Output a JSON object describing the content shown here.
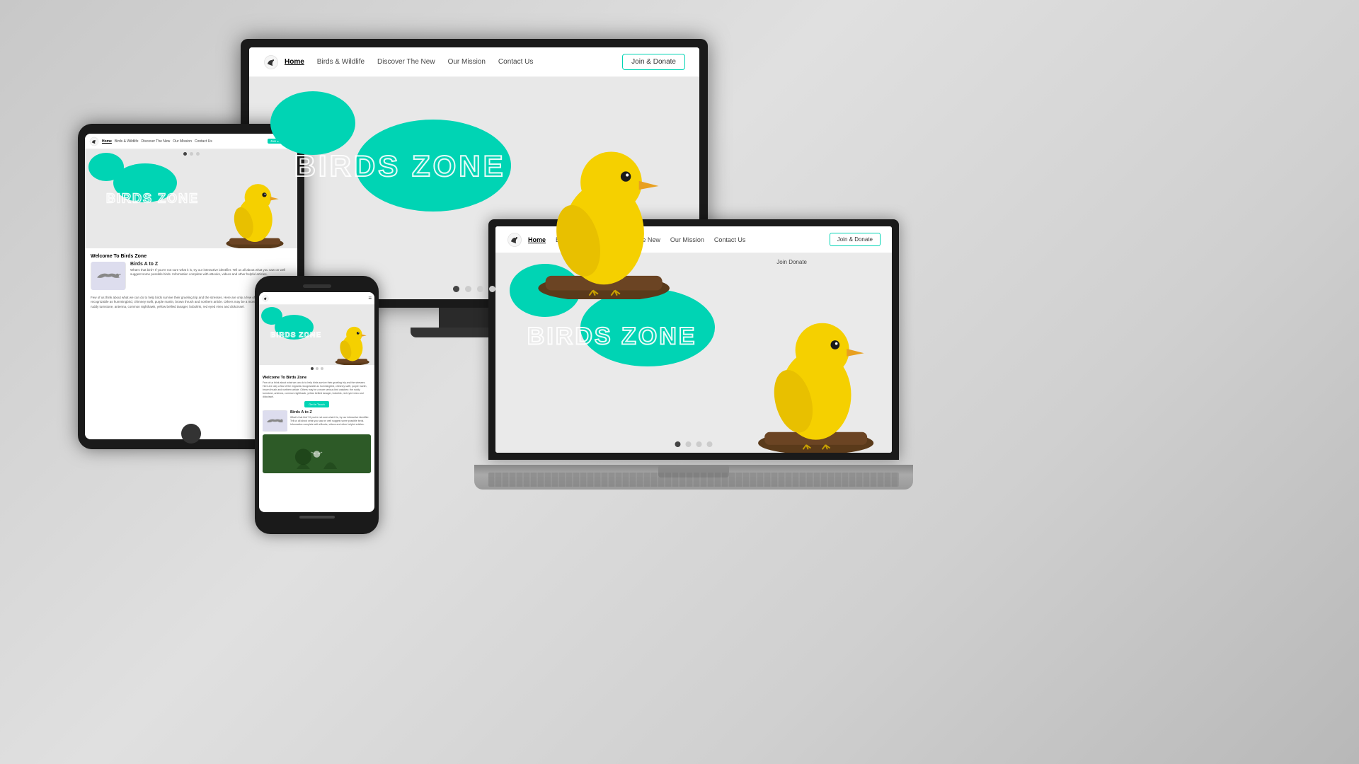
{
  "background": {
    "gradient": "linear-gradient(135deg, #c8c8c8, #e0e0e0, #d0d0d0, #b8b8b8)"
  },
  "website": {
    "nav": {
      "logo_alt": "Birds Zone Logo",
      "links": [
        "Home",
        "Birds & Wildlife",
        "Discover The New",
        "Our Mission",
        "Contact Us"
      ],
      "active_link": "Home",
      "join_donate_btn": "Join & Donate"
    },
    "hero": {
      "title": "BIRDS ZONE",
      "dots": [
        "active",
        "inactive",
        "inactive",
        "inactive"
      ]
    },
    "content": {
      "welcome_title": "Welcome To Birds Zone",
      "welcome_text": "Few of us think about what we can do to help birds survive their grueling trip and the stresses. Here are only a few of the migrants recognizable as hummingbird, chimney swift, purple martin, brown thrush and northern article. Others may be a more serious bird watches: the ruddy turnstone, antenna, common nighthawk, yellow bellied tanager, bobolink, red eyed vireo and dickcissel.",
      "birds_az_title": "Birds A to Z",
      "birds_az_text": "What's that bird? If you're not sure what it is, try our interactive identifier. Tell us all about what you saw on well suggest some possible birds. Information complete with eBooks, videos and other helpful articles.",
      "get_in_touch_btn": "Get in Touch"
    },
    "laptop": {
      "join_donate_text": "Join Donate"
    }
  },
  "icons": {
    "bird_logo": "🐦",
    "hamburger": "≡"
  }
}
